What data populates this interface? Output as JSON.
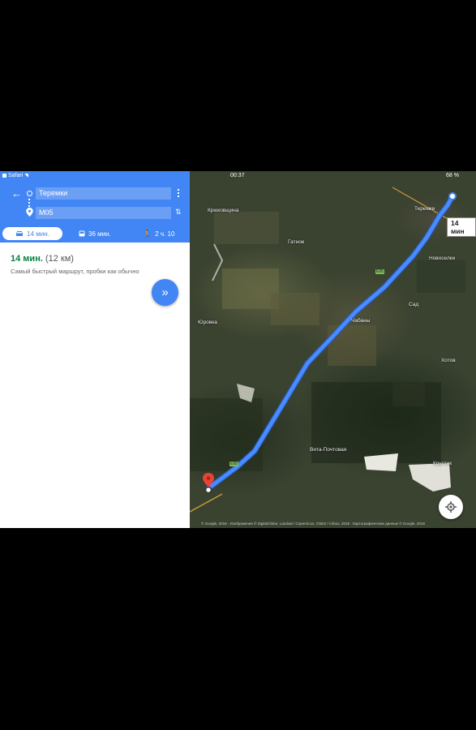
{
  "status_bar": {
    "app": "Safari",
    "time": "00:37",
    "battery": "68 %"
  },
  "directions": {
    "origin": "Теремки",
    "destination": "М05",
    "modes": [
      {
        "icon": "car-icon",
        "label": "14 мин.",
        "selected": true
      },
      {
        "icon": "transit-icon",
        "label": "36 мин.",
        "selected": false
      },
      {
        "icon": "walk-icon",
        "label": "2 ч. 10",
        "selected": false
      }
    ],
    "route": {
      "time": "14 мин.",
      "distance": "(12 км)",
      "description": "Самый быстрый маршрут, пробки как обычно"
    }
  },
  "map": {
    "route_callout": "14 мин",
    "labels": [
      "Крюковщина",
      "Гатное",
      "Теремки",
      "Новоселки",
      "Юровка",
      "Чабаны",
      "Сад",
      "Хотов",
      "Вита-Почтовая",
      "Круглик"
    ],
    "road_badges": [
      "Е95",
      "Е95"
    ],
    "copyright": "© Google, 2018 · Изображения © DigitalGlobe, Landsat / Copernicus, CNES / Airbus, 2018 · Картографические данные © Google, 2018",
    "route_color": "#4285f4"
  },
  "colors": {
    "header": "#4285f4",
    "time_green": "#0b8043",
    "pin_red": "#ea4335"
  }
}
